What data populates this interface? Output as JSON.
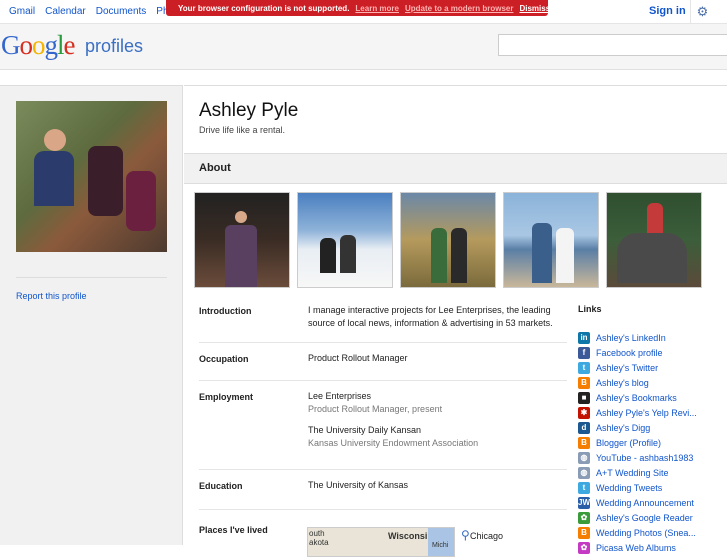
{
  "topnav": [
    "Gmail",
    "Calendar",
    "Documents",
    "Ph"
  ],
  "warning": {
    "text": "Your browser configuration is not supported.",
    "learn_more": "Learn more",
    "update": "Update to a modern browser",
    "dismiss": "Dismiss"
  },
  "signin": "Sign in",
  "logo": {
    "g1": "G",
    "g2": "o",
    "g3": "o",
    "g4": "g",
    "g5": "l",
    "g6": "e"
  },
  "product": "profiles",
  "left": {
    "report": "Report this profile"
  },
  "profile": {
    "name": "Ashley Pyle",
    "tagline": "Drive life like a rental.",
    "about": "About"
  },
  "rows": {
    "intro_label": "Introduction",
    "intro_value": "I manage interactive projects for Lee Enterprises, the leading source of local news, information & advertising in 53 markets.",
    "occ_label": "Occupation",
    "occ_value": "Product Rollout Manager",
    "emp_label": "Employment",
    "emp1_name": "Lee Enterprises",
    "emp1_sub": "Product Rollout Manager, present",
    "emp2_name": "The University Daily Kansan",
    "emp2_sub": "Kansas University Endowment Association",
    "edu_label": "Education",
    "edu_value": "The University of Kansas",
    "places_label": "Places I've lived",
    "places_city": "Chicago"
  },
  "map": {
    "l1": "outh",
    "l2": "akota",
    "wisconsin": "Wisconsin",
    "mich": "Michi"
  },
  "links": {
    "header": "Links",
    "items": [
      {
        "label": "Ashley's LinkedIn",
        "icon": "linkedin-icon",
        "color": "#0e76a8",
        "glyph": "in"
      },
      {
        "label": "Facebook profile",
        "icon": "facebook-icon",
        "color": "#3b5998",
        "glyph": "f"
      },
      {
        "label": "Ashley's Twitter",
        "icon": "twitter-icon",
        "color": "#3ea9e0",
        "glyph": "t"
      },
      {
        "label": "Ashley's blog",
        "icon": "blogger-icon",
        "color": "#f57d00",
        "glyph": "B"
      },
      {
        "label": "Ashley's Bookmarks",
        "icon": "delicious-icon",
        "color": "#222222",
        "glyph": "■"
      },
      {
        "label": "Ashley Pyle's Yelp Revi...",
        "icon": "yelp-icon",
        "color": "#c41200",
        "glyph": "✱"
      },
      {
        "label": "Ashley's Digg",
        "icon": "digg-icon",
        "color": "#1b5891",
        "glyph": "d"
      },
      {
        "label": "Blogger (Profile)",
        "icon": "blogger-icon",
        "color": "#f57d00",
        "glyph": "B"
      },
      {
        "label": "YouTube - ashbash1983",
        "icon": "globe-icon",
        "color": "#8a9bb5",
        "glyph": "◍"
      },
      {
        "label": "A+T Wedding Site",
        "icon": "globe-icon",
        "color": "#8a9bb5",
        "glyph": "◍"
      },
      {
        "label": "Wedding Tweets",
        "icon": "twitter-icon",
        "color": "#3ea9e0",
        "glyph": "t"
      },
      {
        "label": "Wedding Announcement",
        "icon": "jw-icon",
        "color": "#2a5ea8",
        "glyph": "JW"
      },
      {
        "label": "Ashley's Google Reader",
        "icon": "reader-icon",
        "color": "#3a9b3a",
        "glyph": "✿"
      },
      {
        "label": "Wedding Photos (Snea...",
        "icon": "blogger-icon",
        "color": "#f57d00",
        "glyph": "B"
      },
      {
        "label": "Picasa Web Albums",
        "icon": "picasa-icon",
        "color": "#c43ac4",
        "glyph": "✿"
      }
    ]
  }
}
